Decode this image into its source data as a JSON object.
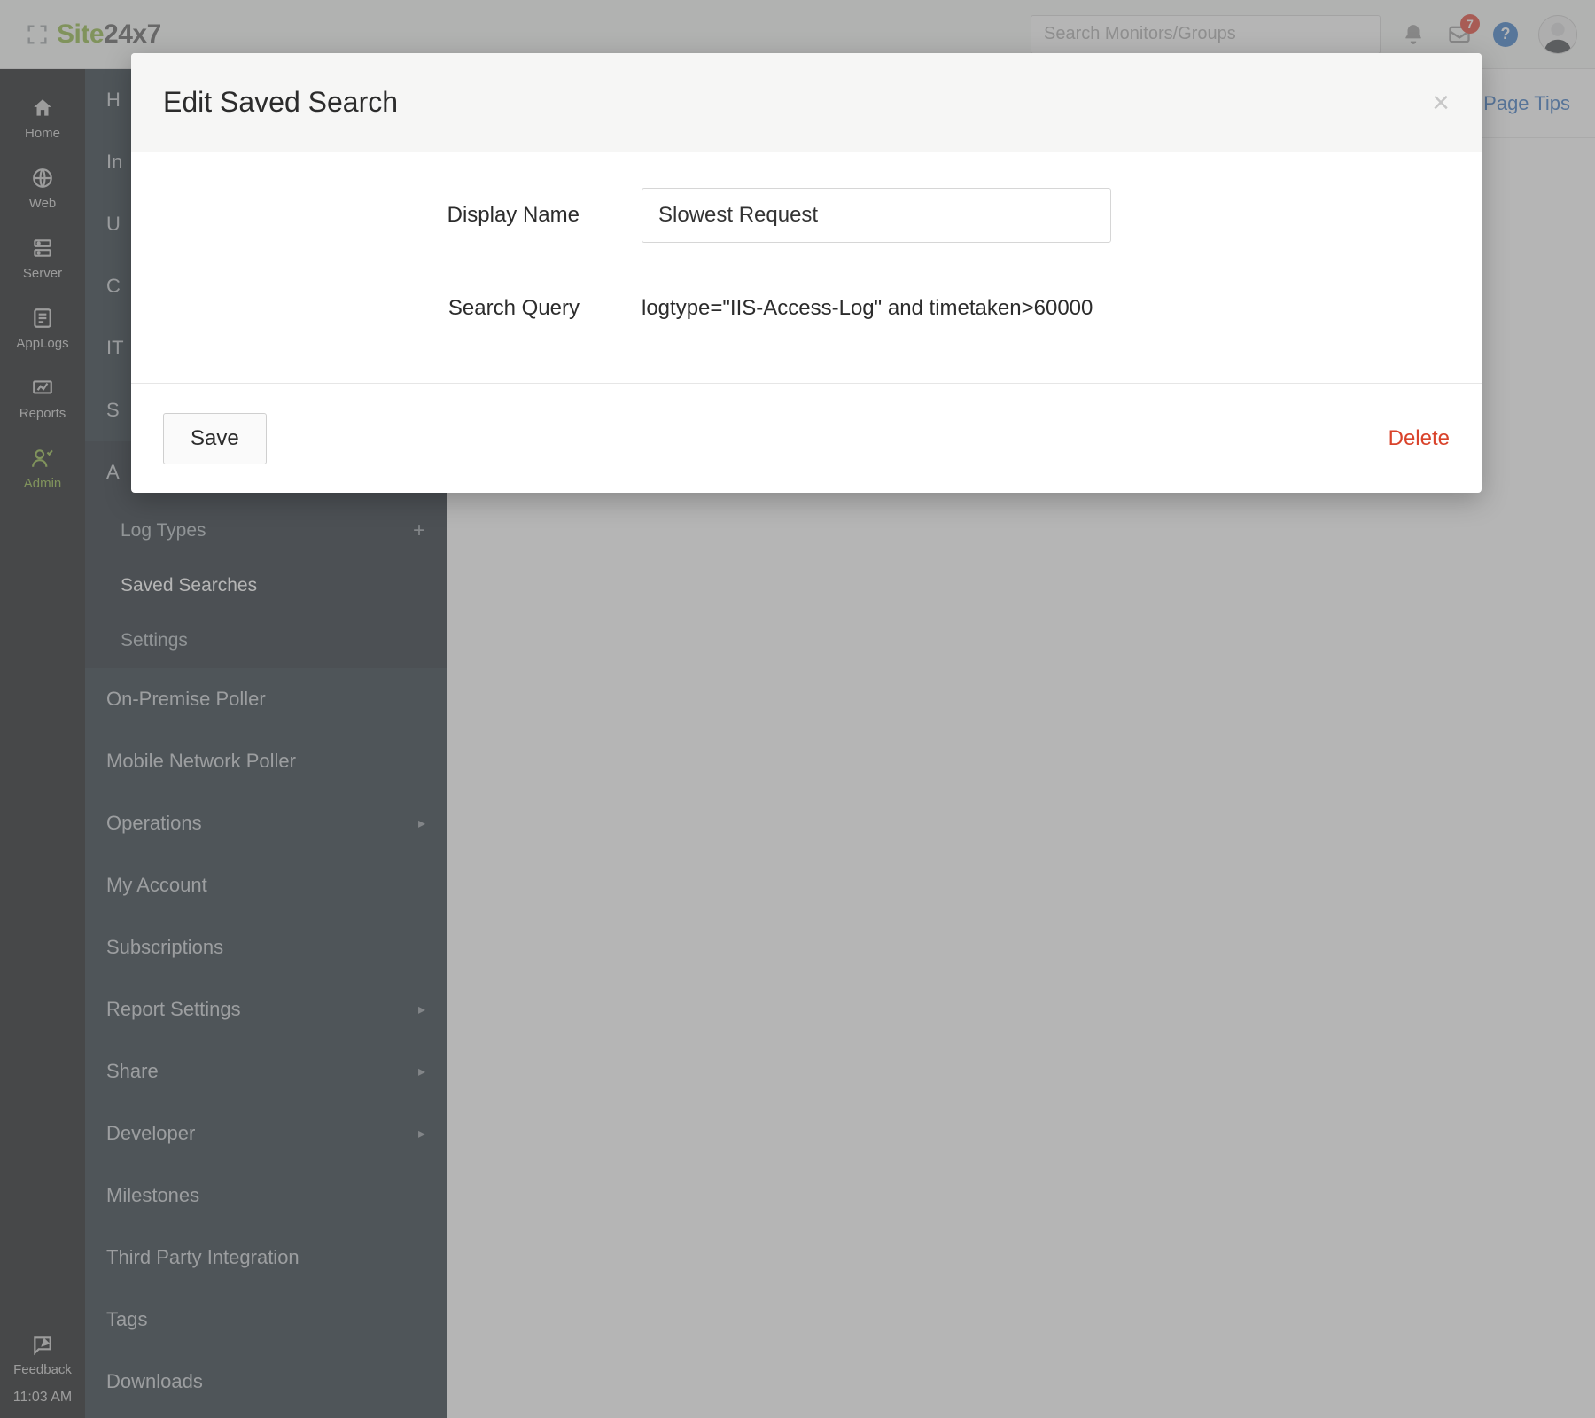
{
  "brand": {
    "site": "Site",
    "num": "24x7"
  },
  "search": {
    "placeholder": "Search Monitors/Groups"
  },
  "notifications": {
    "count": "7"
  },
  "rail": {
    "items": [
      {
        "label": "Home"
      },
      {
        "label": "Web"
      },
      {
        "label": "Server"
      },
      {
        "label": "AppLogs"
      },
      {
        "label": "Reports"
      },
      {
        "label": "Admin"
      }
    ],
    "feedback": "Feedback",
    "time": "11:03 AM"
  },
  "sidebar": {
    "rows": [
      "H",
      "In",
      "U",
      "C",
      "IT",
      "S",
      "A"
    ],
    "subnav": {
      "log_types": "Log Types",
      "saved_searches": "Saved Searches",
      "settings": "Settings"
    },
    "lower": [
      "On-Premise Poller",
      "Mobile Network Poller",
      "Operations",
      "My Account",
      "Subscriptions",
      "Report Settings",
      "Share",
      "Developer",
      "Milestones",
      "Third Party Integration",
      "Tags",
      "Downloads"
    ]
  },
  "content": {
    "page_tips": "Page Tips"
  },
  "modal": {
    "title": "Edit Saved Search",
    "display_name_label": "Display Name",
    "display_name_value": "Slowest Request",
    "search_query_label": "Search Query",
    "search_query_value": "logtype=\"IIS-Access-Log\" and timetaken>60000",
    "save": "Save",
    "delete": "Delete"
  }
}
